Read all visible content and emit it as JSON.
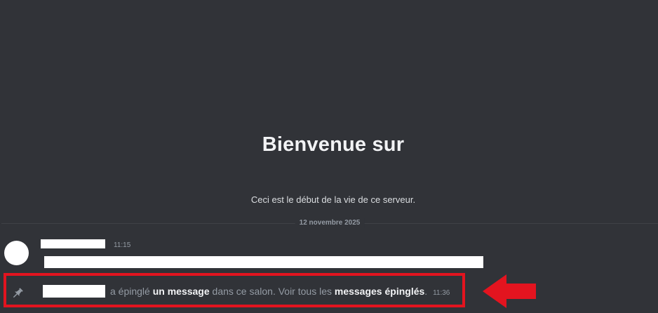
{
  "welcome": {
    "title": "Bienvenue sur",
    "subtitle": "Ceci est le début de la vie de ce serveur."
  },
  "divider": {
    "date_label": "12 novembre 2025"
  },
  "first_message": {
    "timestamp": "11:15",
    "avatar_color": "#ffffff"
  },
  "pin_event": {
    "icon": "pin-icon",
    "text_pinned": "a épinglé",
    "link_message": "un message",
    "text_channel": "dans ce salon. Voir tous les",
    "link_pinned_messages": "messages épinglés",
    "period": ".",
    "timestamp": "11:36"
  },
  "annotation": {
    "highlight_color": "#e3141f",
    "arrow_icon": "left-arrow-icon"
  },
  "theme": {
    "background": "#313338",
    "muted_text": "#949ba4",
    "strong_text": "#f2f3f5"
  }
}
